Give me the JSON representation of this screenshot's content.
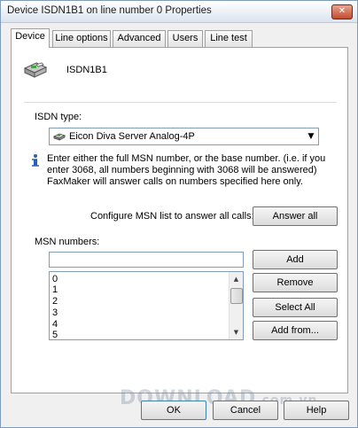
{
  "window": {
    "title": "Device ISDN1B1 on line number 0 Properties",
    "close_label": "✕"
  },
  "tabs": [
    {
      "label": "Device",
      "active": true
    },
    {
      "label": "Line options",
      "active": false
    },
    {
      "label": "Advanced",
      "active": false
    },
    {
      "label": "Users",
      "active": false
    },
    {
      "label": "Line test",
      "active": false
    }
  ],
  "device": {
    "name": "ISDN1B1",
    "icon": "fax-machine-icon"
  },
  "isdn": {
    "label": "ISDN type:",
    "selected": "Eicon Diva Server Analog-4P",
    "icon": "modem-icon"
  },
  "info": {
    "icon": "info-icon",
    "text": "Enter either the full MSN number, or the base number. (i.e. if you enter 3068, all numbers beginning with 3068 will be answered) FaxMaker will answer calls on numbers specified here only."
  },
  "configure": {
    "label": "Configure MSN list to answer all calls:",
    "button": "Answer all"
  },
  "msn": {
    "label": "MSN numbers:",
    "input_value": "",
    "items": [
      "0",
      "1",
      "2",
      "3",
      "4",
      "5"
    ],
    "buttons": {
      "add": "Add",
      "remove": "Remove",
      "select_all": "Select All",
      "add_from": "Add from..."
    }
  },
  "footer": {
    "ok": "OK",
    "cancel": "Cancel",
    "help": "Help"
  },
  "watermark": {
    "text": "DOWNLOAD",
    "suffix": ".com.vn"
  }
}
